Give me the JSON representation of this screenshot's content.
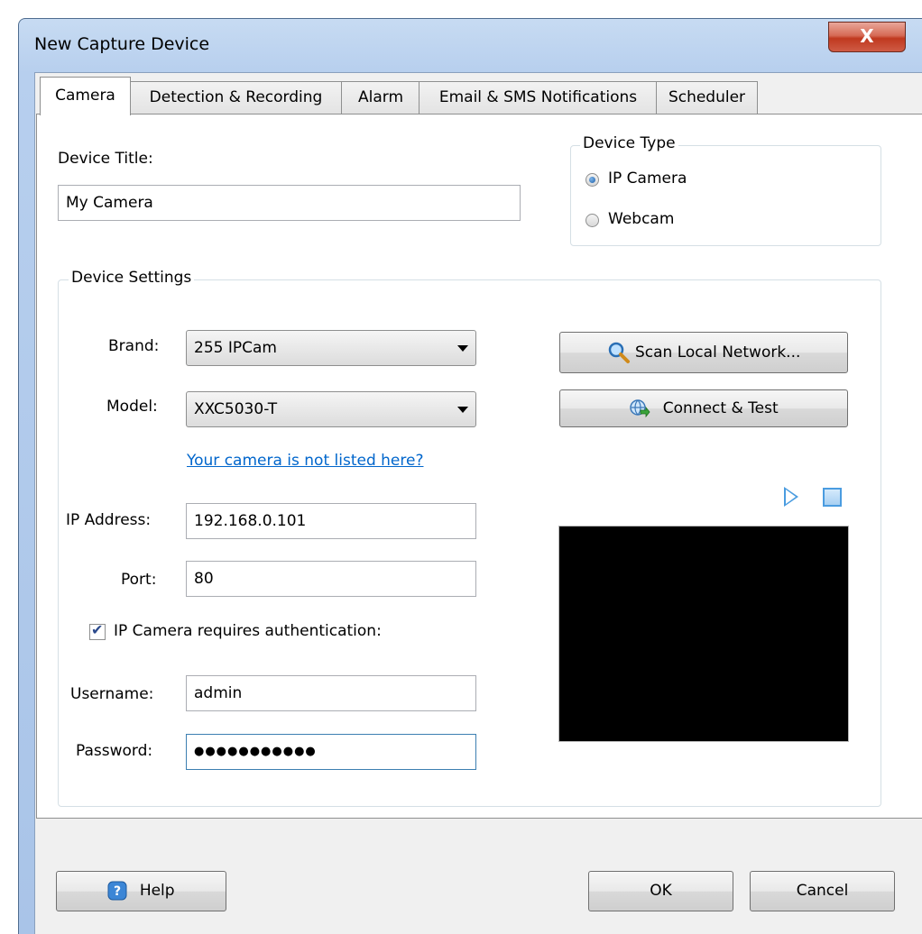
{
  "window": {
    "title": "New Capture Device",
    "close_label": "X"
  },
  "tabs": [
    {
      "label": "Camera",
      "active": true
    },
    {
      "label": "Detection & Recording",
      "active": false
    },
    {
      "label": "Alarm",
      "active": false
    },
    {
      "label": "Email & SMS Notifications",
      "active": false
    },
    {
      "label": "Scheduler",
      "active": false
    }
  ],
  "device_title": {
    "label": "Device Title:",
    "value": "My Camera"
  },
  "device_type": {
    "caption": "Device Type",
    "options": [
      {
        "label": "IP Camera",
        "checked": true
      },
      {
        "label": "Webcam",
        "checked": false
      }
    ]
  },
  "device_settings": {
    "caption": "Device Settings",
    "brand": {
      "label": "Brand:",
      "value": "255 IPCam"
    },
    "model": {
      "label": "Model:",
      "value": "XXC5030-T"
    },
    "not_listed_link": "Your camera is not listed here?",
    "ip_address": {
      "label": "IP Address:",
      "value": "192.168.0.101"
    },
    "port": {
      "label": "Port:",
      "value": "80"
    },
    "auth": {
      "label": "IP Camera requires authentication:",
      "checked": true
    },
    "username": {
      "label": "Username:",
      "value": "admin"
    },
    "password": {
      "label": "Password:",
      "value": "●●●●●●●●●●●"
    },
    "scan_button": "Scan Local Network...",
    "connect_button": "Connect & Test"
  },
  "footer": {
    "help": "Help",
    "ok": "OK",
    "cancel": "Cancel"
  }
}
